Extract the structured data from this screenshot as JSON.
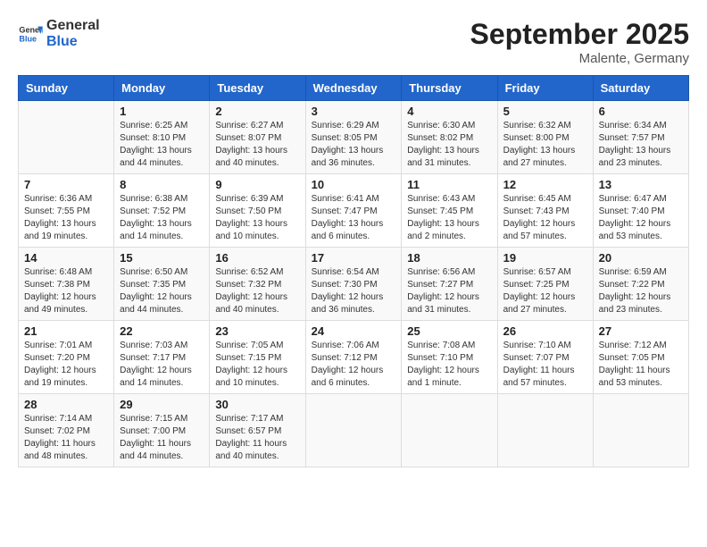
{
  "header": {
    "logo_general": "General",
    "logo_blue": "Blue",
    "month": "September 2025",
    "location": "Malente, Germany"
  },
  "weekdays": [
    "Sunday",
    "Monday",
    "Tuesday",
    "Wednesday",
    "Thursday",
    "Friday",
    "Saturday"
  ],
  "weeks": [
    [
      {
        "day": "",
        "info": ""
      },
      {
        "day": "1",
        "info": "Sunrise: 6:25 AM\nSunset: 8:10 PM\nDaylight: 13 hours\nand 44 minutes."
      },
      {
        "day": "2",
        "info": "Sunrise: 6:27 AM\nSunset: 8:07 PM\nDaylight: 13 hours\nand 40 minutes."
      },
      {
        "day": "3",
        "info": "Sunrise: 6:29 AM\nSunset: 8:05 PM\nDaylight: 13 hours\nand 36 minutes."
      },
      {
        "day": "4",
        "info": "Sunrise: 6:30 AM\nSunset: 8:02 PM\nDaylight: 13 hours\nand 31 minutes."
      },
      {
        "day": "5",
        "info": "Sunrise: 6:32 AM\nSunset: 8:00 PM\nDaylight: 13 hours\nand 27 minutes."
      },
      {
        "day": "6",
        "info": "Sunrise: 6:34 AM\nSunset: 7:57 PM\nDaylight: 13 hours\nand 23 minutes."
      }
    ],
    [
      {
        "day": "7",
        "info": "Sunrise: 6:36 AM\nSunset: 7:55 PM\nDaylight: 13 hours\nand 19 minutes."
      },
      {
        "day": "8",
        "info": "Sunrise: 6:38 AM\nSunset: 7:52 PM\nDaylight: 13 hours\nand 14 minutes."
      },
      {
        "day": "9",
        "info": "Sunrise: 6:39 AM\nSunset: 7:50 PM\nDaylight: 13 hours\nand 10 minutes."
      },
      {
        "day": "10",
        "info": "Sunrise: 6:41 AM\nSunset: 7:47 PM\nDaylight: 13 hours\nand 6 minutes."
      },
      {
        "day": "11",
        "info": "Sunrise: 6:43 AM\nSunset: 7:45 PM\nDaylight: 13 hours\nand 2 minutes."
      },
      {
        "day": "12",
        "info": "Sunrise: 6:45 AM\nSunset: 7:43 PM\nDaylight: 12 hours\nand 57 minutes."
      },
      {
        "day": "13",
        "info": "Sunrise: 6:47 AM\nSunset: 7:40 PM\nDaylight: 12 hours\nand 53 minutes."
      }
    ],
    [
      {
        "day": "14",
        "info": "Sunrise: 6:48 AM\nSunset: 7:38 PM\nDaylight: 12 hours\nand 49 minutes."
      },
      {
        "day": "15",
        "info": "Sunrise: 6:50 AM\nSunset: 7:35 PM\nDaylight: 12 hours\nand 44 minutes."
      },
      {
        "day": "16",
        "info": "Sunrise: 6:52 AM\nSunset: 7:32 PM\nDaylight: 12 hours\nand 40 minutes."
      },
      {
        "day": "17",
        "info": "Sunrise: 6:54 AM\nSunset: 7:30 PM\nDaylight: 12 hours\nand 36 minutes."
      },
      {
        "day": "18",
        "info": "Sunrise: 6:56 AM\nSunset: 7:27 PM\nDaylight: 12 hours\nand 31 minutes."
      },
      {
        "day": "19",
        "info": "Sunrise: 6:57 AM\nSunset: 7:25 PM\nDaylight: 12 hours\nand 27 minutes."
      },
      {
        "day": "20",
        "info": "Sunrise: 6:59 AM\nSunset: 7:22 PM\nDaylight: 12 hours\nand 23 minutes."
      }
    ],
    [
      {
        "day": "21",
        "info": "Sunrise: 7:01 AM\nSunset: 7:20 PM\nDaylight: 12 hours\nand 19 minutes."
      },
      {
        "day": "22",
        "info": "Sunrise: 7:03 AM\nSunset: 7:17 PM\nDaylight: 12 hours\nand 14 minutes."
      },
      {
        "day": "23",
        "info": "Sunrise: 7:05 AM\nSunset: 7:15 PM\nDaylight: 12 hours\nand 10 minutes."
      },
      {
        "day": "24",
        "info": "Sunrise: 7:06 AM\nSunset: 7:12 PM\nDaylight: 12 hours\nand 6 minutes."
      },
      {
        "day": "25",
        "info": "Sunrise: 7:08 AM\nSunset: 7:10 PM\nDaylight: 12 hours\nand 1 minute."
      },
      {
        "day": "26",
        "info": "Sunrise: 7:10 AM\nSunset: 7:07 PM\nDaylight: 11 hours\nand 57 minutes."
      },
      {
        "day": "27",
        "info": "Sunrise: 7:12 AM\nSunset: 7:05 PM\nDaylight: 11 hours\nand 53 minutes."
      }
    ],
    [
      {
        "day": "28",
        "info": "Sunrise: 7:14 AM\nSunset: 7:02 PM\nDaylight: 11 hours\nand 48 minutes."
      },
      {
        "day": "29",
        "info": "Sunrise: 7:15 AM\nSunset: 7:00 PM\nDaylight: 11 hours\nand 44 minutes."
      },
      {
        "day": "30",
        "info": "Sunrise: 7:17 AM\nSunset: 6:57 PM\nDaylight: 11 hours\nand 40 minutes."
      },
      {
        "day": "",
        "info": ""
      },
      {
        "day": "",
        "info": ""
      },
      {
        "day": "",
        "info": ""
      },
      {
        "day": "",
        "info": ""
      }
    ]
  ]
}
